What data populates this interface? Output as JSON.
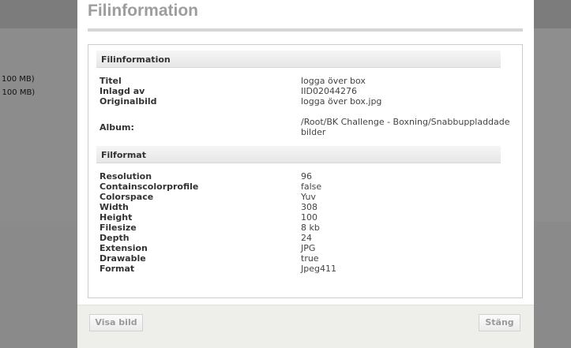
{
  "background": {
    "line1": "100 MB)",
    "line2": "/ 100 MB)"
  },
  "dialog": {
    "title": "Filinformation",
    "sections": {
      "file_info": {
        "heading": "Filinformation",
        "rows": [
          {
            "key": "Titel",
            "value": "logga över box"
          },
          {
            "key": "Inlagd av",
            "value": "IID02044276"
          },
          {
            "key": "Originalbild",
            "value": "logga över box.jpg"
          },
          {
            "key": "Album:",
            "value": "/Root/BK Challenge - Boxning/Snabbuppladdade bilder"
          }
        ]
      },
      "file_format": {
        "heading": "Filformat",
        "rows": [
          {
            "key": "Resolution",
            "value": "96"
          },
          {
            "key": "Containscolorprofile",
            "value": "false"
          },
          {
            "key": "Colorspace",
            "value": "Yuv"
          },
          {
            "key": "Width",
            "value": "308"
          },
          {
            "key": "Height",
            "value": "100"
          },
          {
            "key": "Filesize",
            "value": "8 kb"
          },
          {
            "key": "Depth",
            "value": "24"
          },
          {
            "key": "Extension",
            "value": "JPG"
          },
          {
            "key": "Drawable",
            "value": "true"
          },
          {
            "key": "Format",
            "value": "Jpeg411"
          }
        ]
      }
    },
    "footer": {
      "show_image_label": "Visa bild",
      "close_label": "Stäng"
    }
  }
}
